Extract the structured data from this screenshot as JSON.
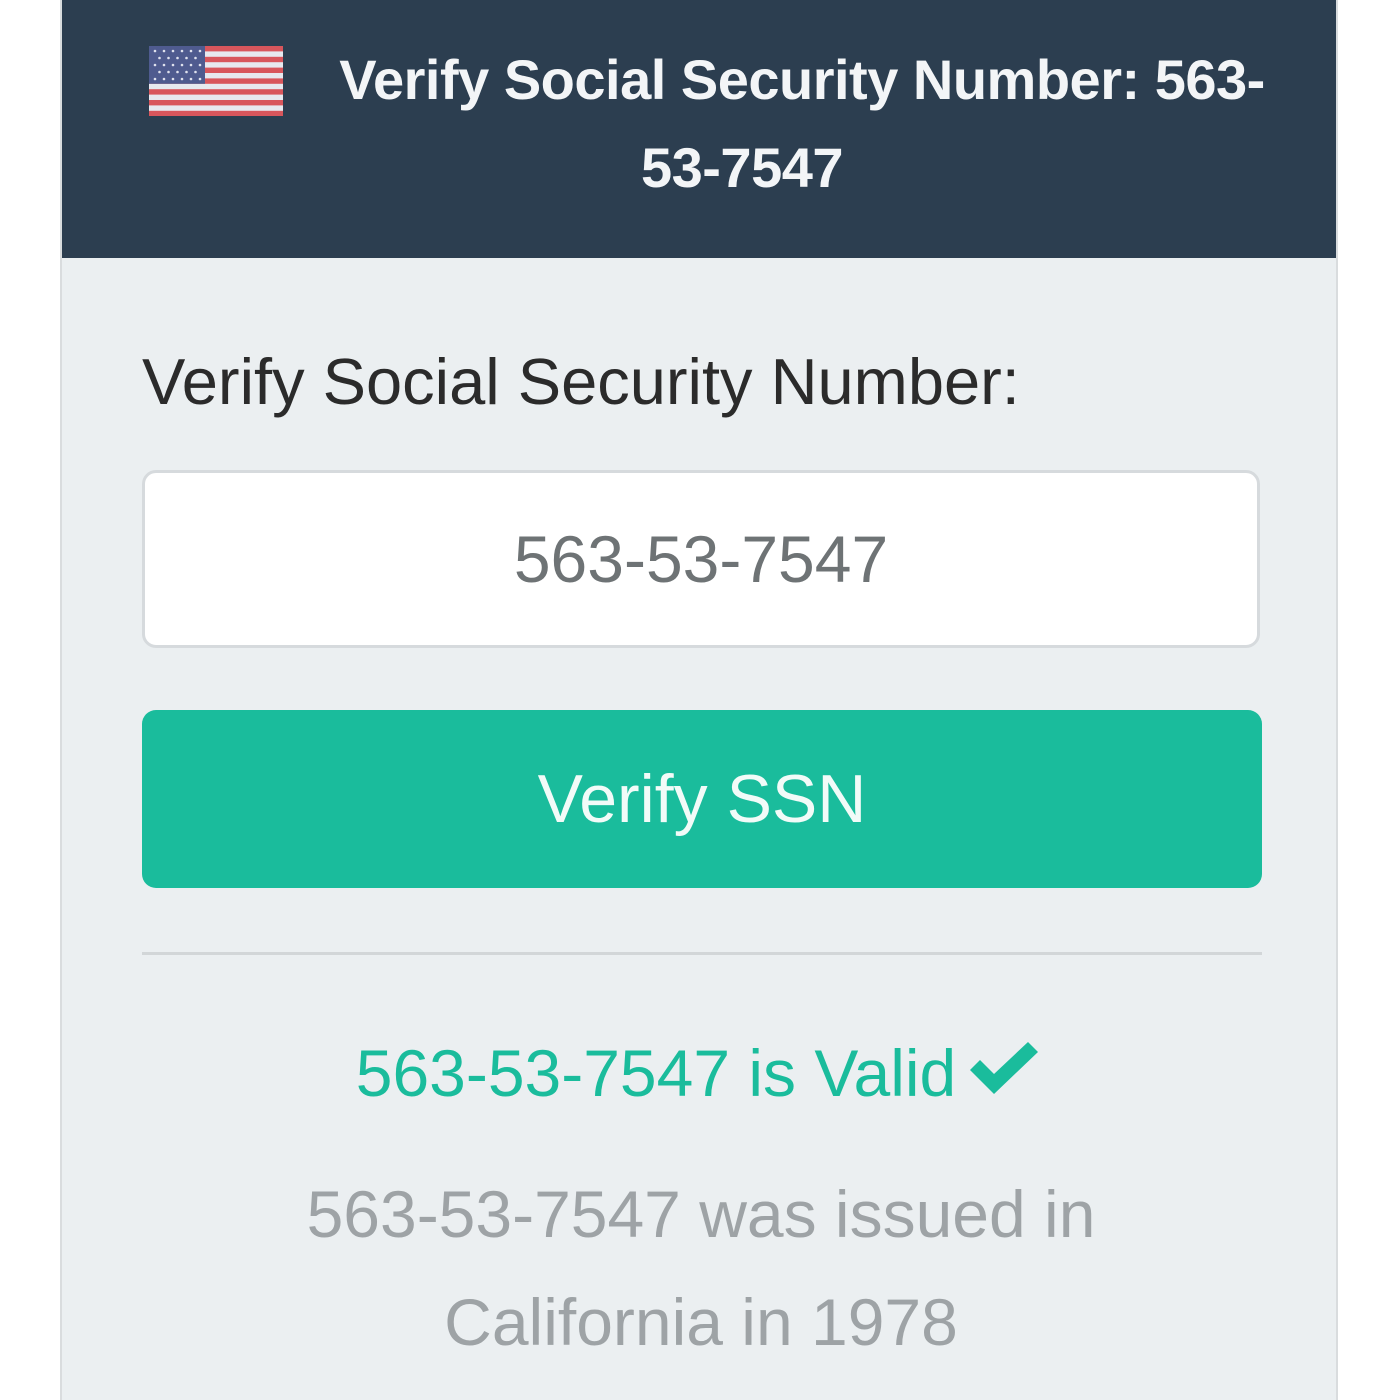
{
  "colors": {
    "header_bg": "#2c3e50",
    "card_bg": "#ebeff1",
    "accent": "#1abc9c",
    "muted_text": "#9ea3a6"
  },
  "header": {
    "flag_icon": "us-flag-icon",
    "title": "Verify Social Security Number: 563-53-7547"
  },
  "form": {
    "label": "Verify Social Security Number:",
    "ssn_value": "563-53-7547",
    "submit_label": "Verify SSN"
  },
  "result": {
    "valid_text": "563-53-7547 is Valid",
    "check_icon": "checkmark-icon",
    "info_text": "563-53-7547 was issued in California in 1978"
  }
}
